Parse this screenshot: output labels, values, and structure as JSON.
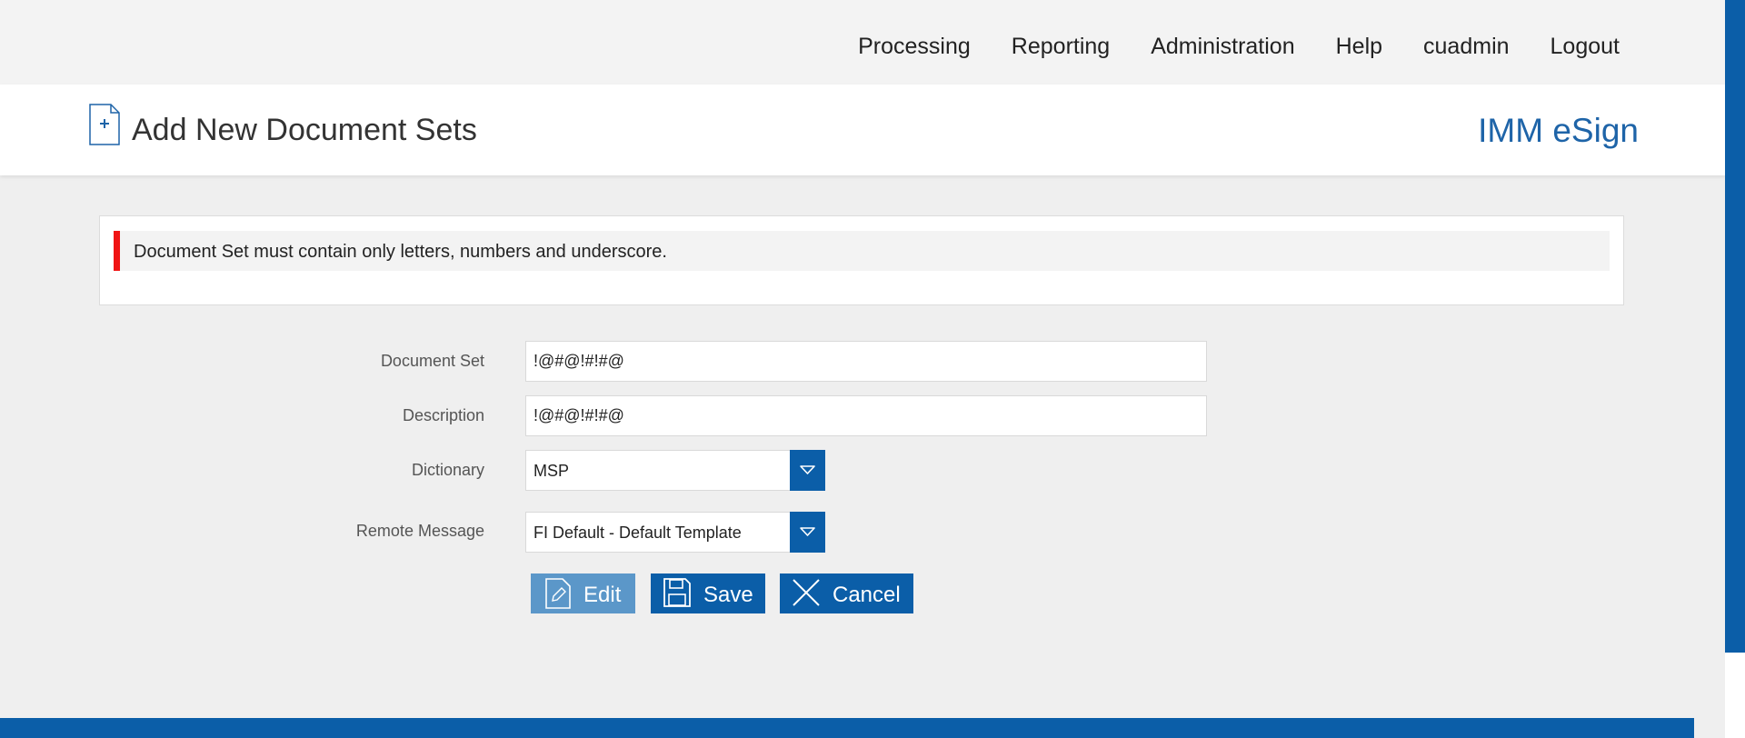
{
  "nav": {
    "items": [
      "Processing",
      "Reporting",
      "Administration",
      "Help",
      "cuadmin",
      "Logout"
    ]
  },
  "header": {
    "title": "Add New Document Sets",
    "brand": "IMM eSign"
  },
  "error": {
    "message": "Document Set must contain only letters, numbers and underscore."
  },
  "form": {
    "document_set": {
      "label": "Document Set",
      "value": "!@#@!#!#@"
    },
    "description": {
      "label": "Description",
      "value": "!@#@!#!#@"
    },
    "dictionary": {
      "label": "Dictionary",
      "value": "MSP"
    },
    "remote_message": {
      "label": "Remote Message",
      "value": "FI Default - Default Template"
    }
  },
  "buttons": {
    "edit": "Edit",
    "save": "Save",
    "cancel": "Cancel"
  },
  "colors": {
    "accent": "#0b5ea8",
    "brand": "#1e64a8",
    "error": "#f01414",
    "disabled_button": "#5b97c9"
  },
  "icons": {
    "header": "add-document-icon",
    "select": "chevron-down-icon",
    "edit": "pencil-document-icon",
    "save": "floppy-disk-icon",
    "cancel": "close-icon"
  }
}
